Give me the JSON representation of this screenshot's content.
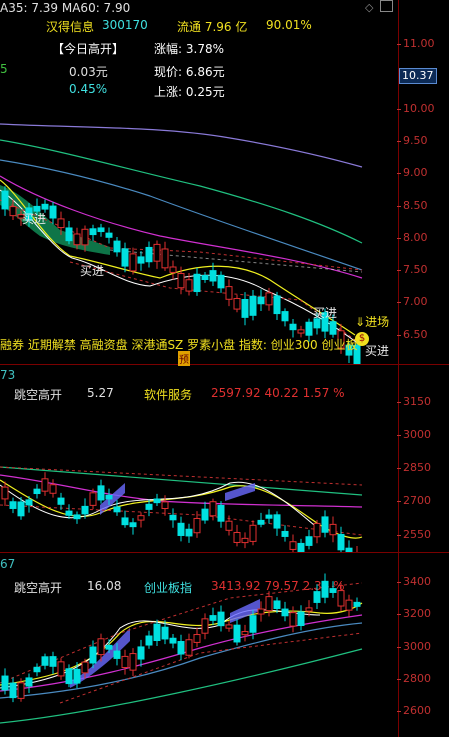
{
  "main": {
    "ma_line": "A35: 7.39  MA60: 7.90",
    "stock_name": "汉得信息",
    "stock_code": "300170",
    "float_label": "流通 7.96 亿",
    "float_pct": "90.01%",
    "today_gap": "【今日高开】",
    "change_pct_label": "涨幅:",
    "change_pct_value": "3.78%",
    "price_label": "现价:",
    "price_value": "6.86元",
    "rise_label": "上涨:",
    "rise_value": "0.25元",
    "gap_amount": "0.03元",
    "gap_pct": "0.45%",
    "left_marker": "5",
    "concepts": "融券 近期解禁 高融资盘 深港通SZ 罗素小盘  指数: 创业300 创业板",
    "yu_tag": "预",
    "current_price": "10.37",
    "signals": [
      "买进",
      "买进",
      "买进",
      "进场",
      "买进"
    ],
    "axis": [
      "11.00",
      "10.50",
      "10.00",
      "9.50",
      "9.00",
      "8.50",
      "8.00",
      "7.50",
      "7.00",
      "6.50"
    ]
  },
  "sector": {
    "left_marker": "73",
    "label": "跳空高开",
    "value": "5.27",
    "name": "软件服务",
    "quote": "2597.92  40.22  1.57 %",
    "axis": [
      "3150",
      "3000",
      "2850",
      "2700",
      "2550"
    ]
  },
  "index": {
    "left_marker": "67",
    "label": "跳空高开",
    "value": "16.08",
    "name": "创业板指",
    "quote": "3413.92  79.57  2.39 %",
    "axis": [
      "3400",
      "3200",
      "3000",
      "2800",
      "2600"
    ]
  },
  "colors": {
    "up": "#e03030",
    "down": "#00e0e0",
    "grid": "#7a0000"
  }
}
